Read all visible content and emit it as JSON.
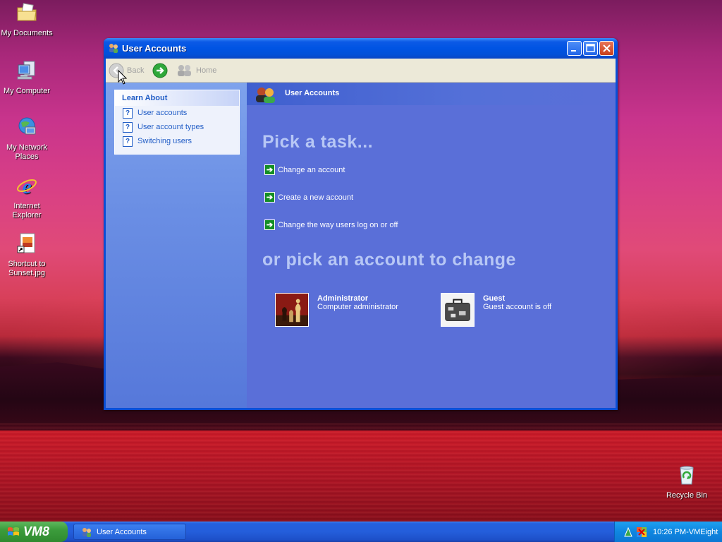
{
  "desktop": {
    "icons": [
      {
        "label": "My Documents"
      },
      {
        "label": "My Computer"
      },
      {
        "label": "My Network Places"
      },
      {
        "label": "Internet Explorer"
      },
      {
        "label": "Shortcut to Sunset.jpg"
      },
      {
        "label": "Recycle Bin"
      }
    ]
  },
  "window": {
    "title": "User Accounts",
    "toolbar": {
      "back": "Back",
      "home": "Home"
    },
    "header_title": "User Accounts",
    "learn_about": {
      "title": "Learn About",
      "items": [
        "User accounts",
        "User account types",
        "Switching users"
      ]
    },
    "pick_task_title": "Pick a task...",
    "tasks": [
      "Change an account",
      "Create a new account",
      "Change the way users log on or off"
    ],
    "pick_account_title": "or pick an account to change",
    "accounts": [
      {
        "name": "Administrator",
        "description": "Computer administrator"
      },
      {
        "name": "Guest",
        "description": "Guest account is off"
      }
    ]
  },
  "taskbar": {
    "start_label": "VM8",
    "window_button": "User Accounts",
    "clock": "10:26 PM-VMEight"
  },
  "colors": {
    "title_blue": "#0054e3",
    "task_green": "#138e24",
    "pane_blue": "#5a6fd8",
    "link_blue": "#215dc6"
  }
}
